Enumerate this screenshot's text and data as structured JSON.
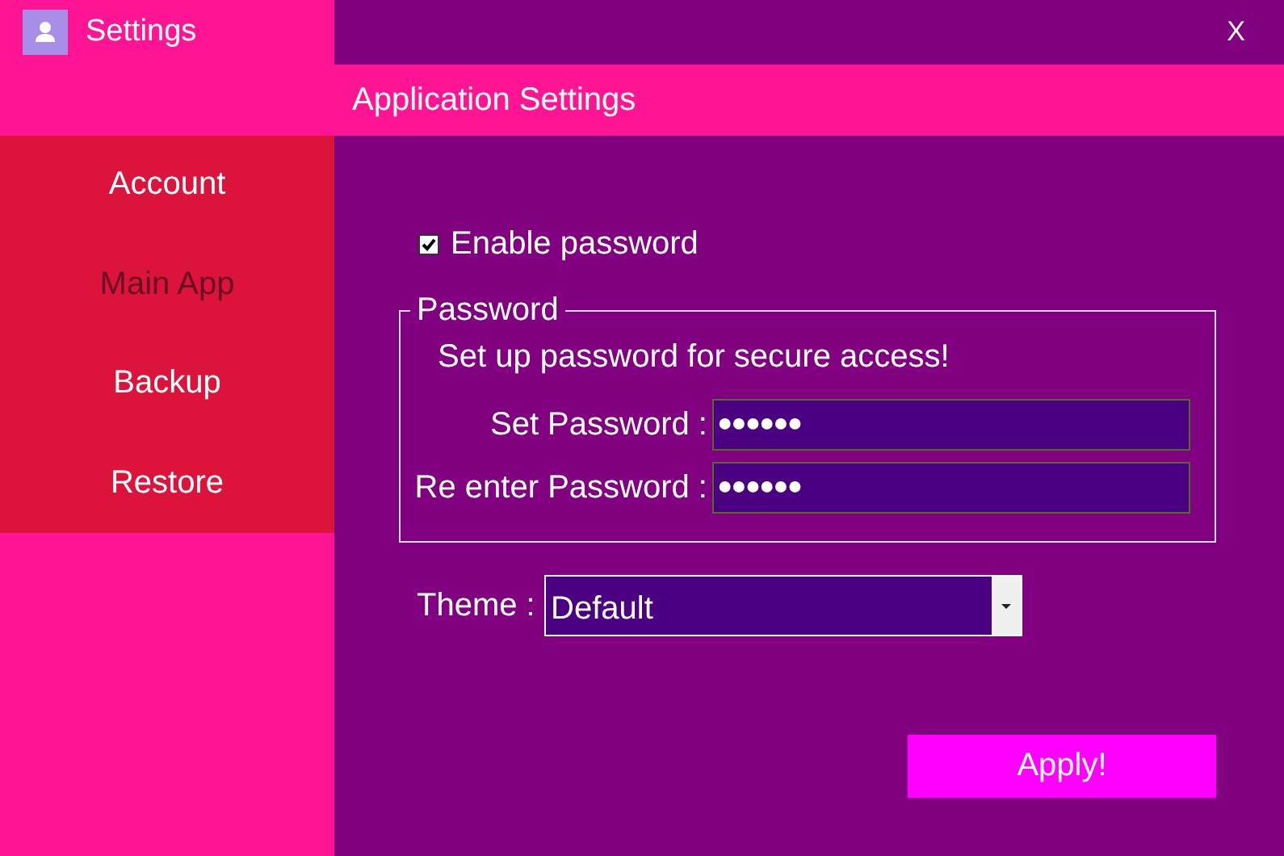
{
  "window": {
    "title": "Settings",
    "close": "X"
  },
  "header": {
    "title": "Application Settings"
  },
  "sidebar": {
    "items": [
      {
        "label": "Account",
        "selected": false
      },
      {
        "label": "Main App",
        "selected": true
      },
      {
        "label": "Backup",
        "selected": false
      },
      {
        "label": "Restore",
        "selected": false
      }
    ]
  },
  "enable_password": {
    "label": "Enable password",
    "checked": true
  },
  "password_group": {
    "legend": "Password",
    "hint": "Set up password for secure access!",
    "fields": [
      {
        "label": "Set Password :",
        "value": "●●●●●●"
      },
      {
        "label": "Re enter Password :",
        "value": "●●●●●●"
      }
    ]
  },
  "theme": {
    "label": "Theme :",
    "value": "Default"
  },
  "apply_button": "Apply!"
}
